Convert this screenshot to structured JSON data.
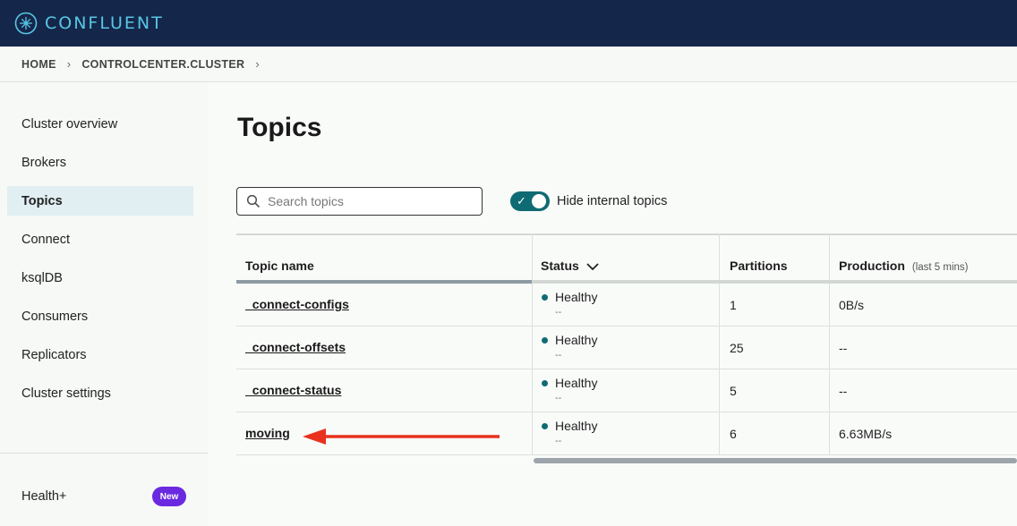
{
  "app": {
    "brand": "CONFLUENT"
  },
  "breadcrumb": {
    "home": "HOME",
    "cluster": "CONTROLCENTER.CLUSTER"
  },
  "sidebar": {
    "items": [
      {
        "label": "Cluster overview"
      },
      {
        "label": "Brokers"
      },
      {
        "label": "Topics",
        "active": true
      },
      {
        "label": "Connect"
      },
      {
        "label": "ksqlDB"
      },
      {
        "label": "Consumers"
      },
      {
        "label": "Replicators"
      },
      {
        "label": "Cluster settings"
      }
    ],
    "health": {
      "label": "Health+",
      "badge": "New"
    }
  },
  "main": {
    "title": "Topics",
    "search": {
      "placeholder": "Search topics",
      "value": ""
    },
    "toggle": {
      "label": "Hide internal topics",
      "on": true
    },
    "table": {
      "columns": [
        {
          "label": "Topic name"
        },
        {
          "label": "Status"
        },
        {
          "label": "Partitions"
        },
        {
          "label": "Production",
          "sub": "(last 5 mins)"
        }
      ],
      "rows": [
        {
          "name": "_connect-configs",
          "status": "Healthy",
          "status_sub": "--",
          "partitions": "1",
          "production": "0B/s"
        },
        {
          "name": "_connect-offsets",
          "status": "Healthy",
          "status_sub": "--",
          "partitions": "25",
          "production": "--"
        },
        {
          "name": "_connect-status",
          "status": "Healthy",
          "status_sub": "--",
          "partitions": "5",
          "production": "--"
        },
        {
          "name": "moving",
          "status": "Healthy",
          "status_sub": "--",
          "partitions": "6",
          "production": "6.63MB/s"
        }
      ]
    }
  },
  "colors": {
    "topbar": "#15264b",
    "accent": "#0f6b73",
    "badge": "#6a2ae0",
    "arrow": "#e8321e"
  }
}
